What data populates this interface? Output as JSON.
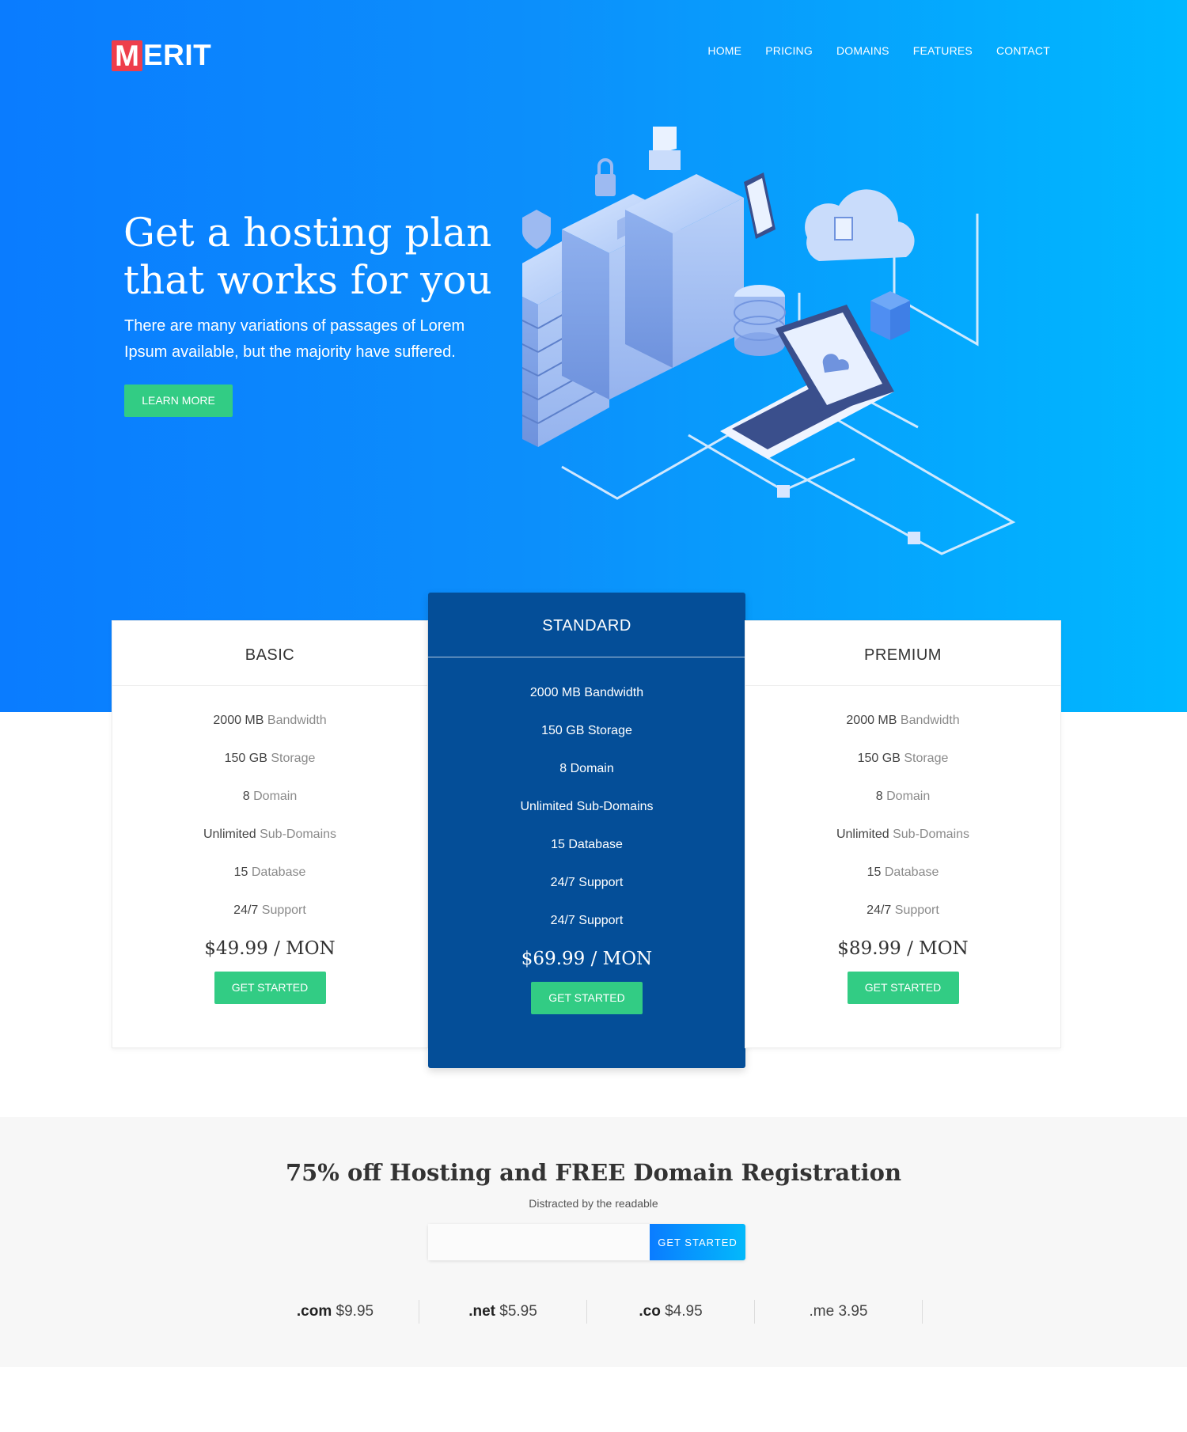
{
  "brand": {
    "logo_first": "M",
    "logo_rest": "ERIT"
  },
  "nav": {
    "items": [
      "HOME",
      "PRICING",
      "DOMAINS",
      "FEATURES",
      "CONTACT"
    ]
  },
  "hero": {
    "title": "Get a hosting plan that works for you",
    "subtitle": "There are many variations of passages of Lorem Ipsum available, but the majority have suffered.",
    "cta": "LEARN MORE"
  },
  "plans": [
    {
      "name": "BASIC",
      "features": [
        {
          "value": "2000 MB",
          "label": "Bandwidth"
        },
        {
          "value": "150 GB",
          "label": "Storage"
        },
        {
          "value": "8",
          "label": "Domain"
        },
        {
          "value": "Unlimited",
          "label": "Sub-Domains"
        },
        {
          "value": "15",
          "label": "Database"
        },
        {
          "value": "24/7",
          "label": "Support"
        }
      ],
      "price": "$49.99 / MON",
      "cta": "GET STARTED"
    },
    {
      "name": "STANDARD",
      "features": [
        {
          "value": "2000 MB",
          "label": "Bandwidth"
        },
        {
          "value": "150 GB",
          "label": "Storage"
        },
        {
          "value": "8",
          "label": "Domain"
        },
        {
          "value": "Unlimited",
          "label": "Sub-Domains"
        },
        {
          "value": "15",
          "label": "Database"
        },
        {
          "value": "24/7",
          "label": "Support"
        },
        {
          "value": "24/7",
          "label": "Support"
        }
      ],
      "price": "$69.99 / MON",
      "cta": "GET STARTED"
    },
    {
      "name": "PREMIUM",
      "features": [
        {
          "value": "2000 MB",
          "label": "Bandwidth"
        },
        {
          "value": "150 GB",
          "label": "Storage"
        },
        {
          "value": "8",
          "label": "Domain"
        },
        {
          "value": "Unlimited",
          "label": "Sub-Domains"
        },
        {
          "value": "15",
          "label": "Database"
        },
        {
          "value": "24/7",
          "label": "Support"
        }
      ],
      "price": "$89.99 / MON",
      "cta": "GET STARTED"
    }
  ],
  "promo": {
    "title": "75% off Hosting and FREE Domain Registration",
    "subtitle": "Distracted by the readable",
    "input_value": "",
    "button": "GET STARTED"
  },
  "domains": [
    {
      "tld": ".com",
      "price": "$9.95"
    },
    {
      "tld": ".net",
      "price": "$5.95"
    },
    {
      "tld": ".co",
      "price": "$4.95"
    },
    {
      "tld": ".me",
      "price": "3.95"
    }
  ],
  "colors": {
    "hero_start": "#0a7cff",
    "hero_end": "#00b8ff",
    "accent_green": "#32cc84",
    "standard_bg": "#044e98",
    "logo_red": "#ee3e4b"
  }
}
